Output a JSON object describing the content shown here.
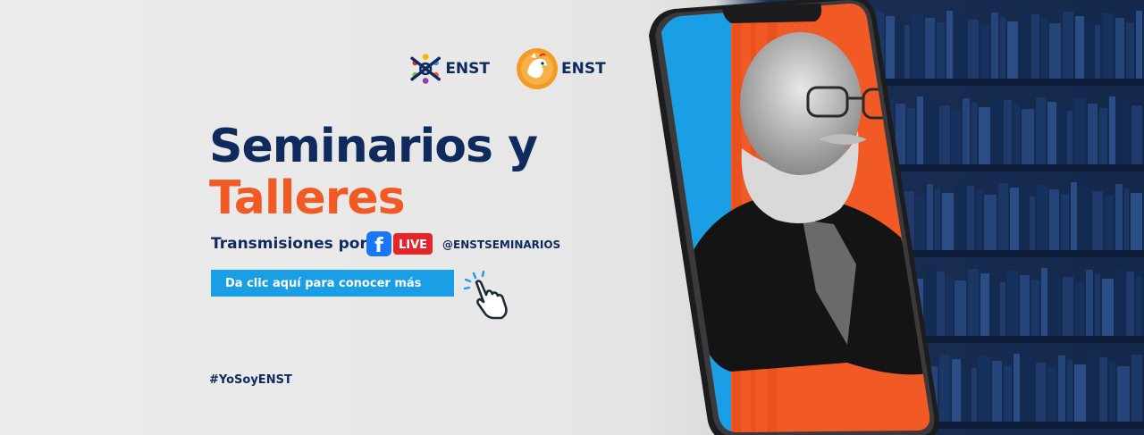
{
  "colors": {
    "navy": "#0f2a5c",
    "orange": "#f15a24",
    "cta_blue": "#1a9ee5",
    "facebook_blue": "#1877f2",
    "live_red": "#e4262b",
    "shelf_blue": "#1b2f55"
  },
  "logos": [
    {
      "icon": "enst-network-icon",
      "text": "ENST"
    },
    {
      "icon": "enst-mascot-icon",
      "text": "ENST"
    }
  ],
  "headline": {
    "line1": "Seminarios y",
    "line2": "Talleres"
  },
  "broadcast": {
    "label": "Transmisiones por",
    "badge_icon": "facebook-live-icon",
    "badge_text": "LIVE",
    "fb_letter": "f",
    "handle": "@ENSTSEMINARIOS"
  },
  "cta": {
    "label": "Da clic aquí para conocer más",
    "icon": "pointing-hand-icon"
  },
  "hashtag": "#YoSoyENST"
}
